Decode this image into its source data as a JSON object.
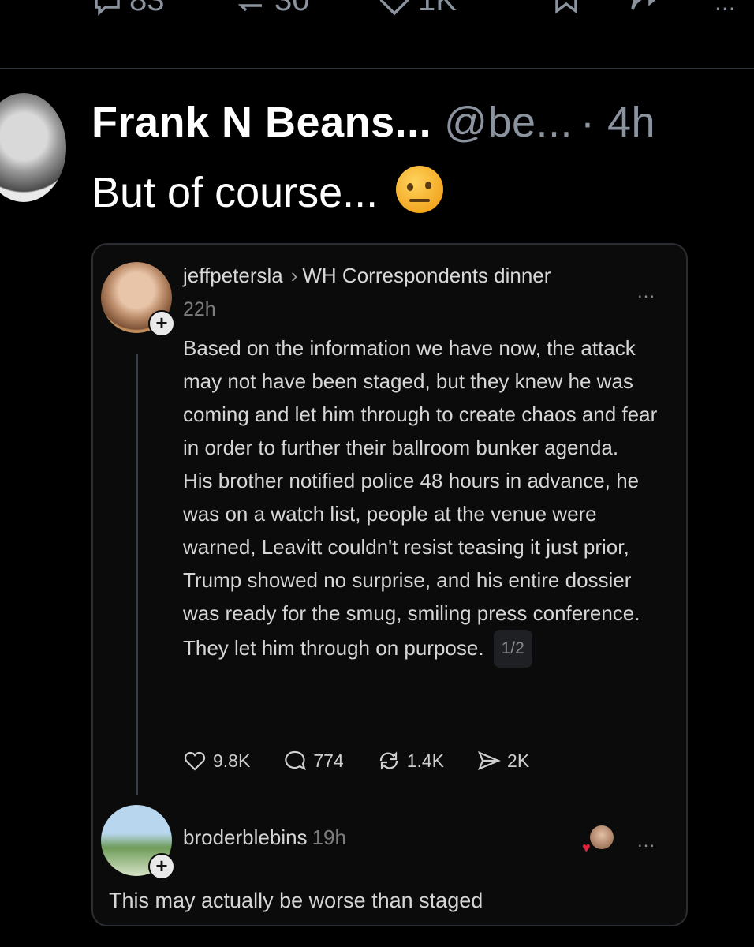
{
  "top_actions": {
    "reply_count": "83",
    "repost_count": "30",
    "like_count": "1K",
    "more_label": "..."
  },
  "post": {
    "display_name": "Frank N Beans...",
    "handle": "@be...",
    "time": "· 4h",
    "text": "But of course..."
  },
  "embedded": {
    "username": "jeffpetersla",
    "topic": "WH Correspondents dinner",
    "time": "22h",
    "more_label": "...",
    "plus_label": "+",
    "paragraphs": [
      "Based on the information we have now, the attack may not have been staged, but they knew he was coming and let him through to create chaos and fear in order to further their ballroom bunker agenda.",
      "His brother notified police 48 hours in advance, he was on a watch list, people at the venue were warned, Leavitt couldn't resist teasing it just prior, Trump showed no surprise, and his entire dossier was ready for the smug, smiling press conference.",
      "They let him through on purpose."
    ],
    "pager": "1/2",
    "stats": {
      "likes": "9.8K",
      "comments": "774",
      "reposts": "1.4K",
      "shares": "2K"
    }
  },
  "reply": {
    "username": "broderblebins",
    "time": "19h",
    "more_label": "...",
    "plus_label": "+",
    "text": "This may actually be worse than staged"
  }
}
